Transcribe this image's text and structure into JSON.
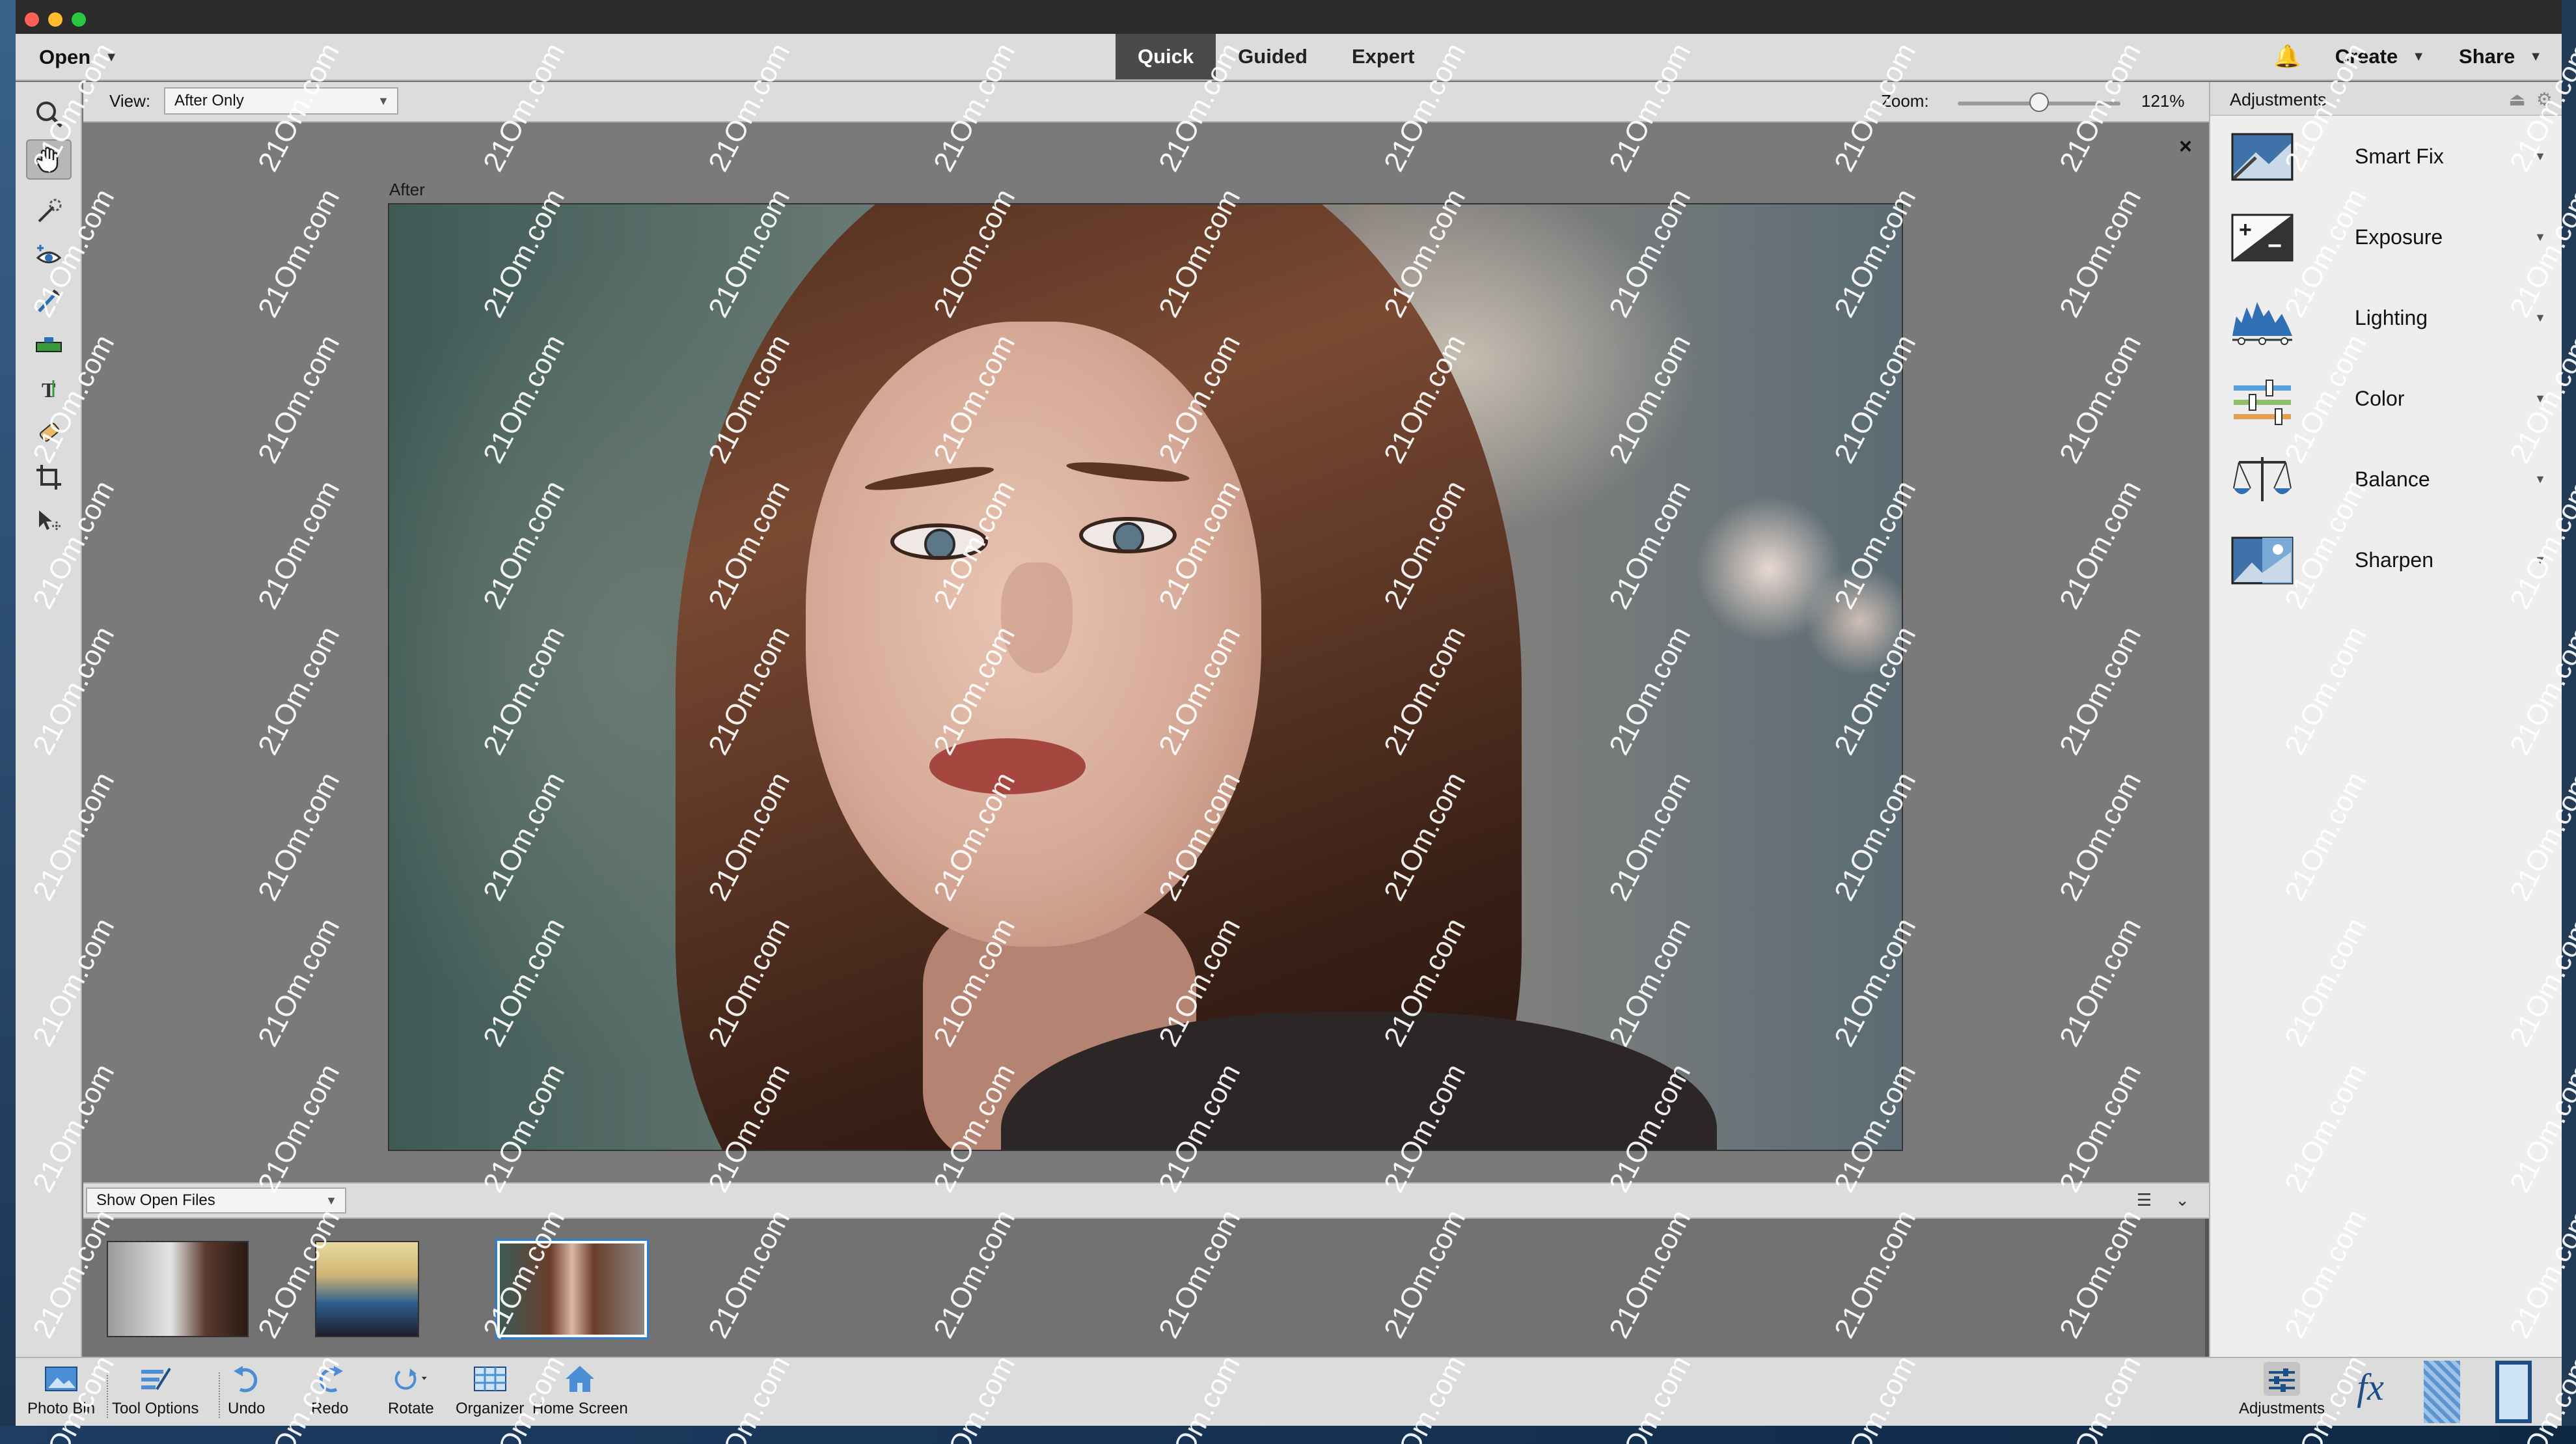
{
  "window": {
    "traffic_colors": [
      "#ff5f57",
      "#febc2e",
      "#28c840"
    ]
  },
  "topbar": {
    "open_label": "Open",
    "modes": [
      {
        "label": "Quick",
        "active": true
      },
      {
        "label": "Guided",
        "active": false
      },
      {
        "label": "Expert",
        "active": false
      }
    ],
    "create_label": "Create",
    "share_label": "Share"
  },
  "viewbar": {
    "view_label": "View:",
    "view_value": "After Only",
    "zoom_label": "Zoom:",
    "zoom_value": "121%"
  },
  "canvas": {
    "after_label": "After",
    "close_glyph": "×"
  },
  "bin": {
    "show_label": "Show Open Files",
    "thumbnails": [
      {
        "selected": false
      },
      {
        "selected": false
      },
      {
        "selected": true
      }
    ]
  },
  "panel": {
    "title": "Adjustments",
    "items": [
      {
        "label": "Smart Fix",
        "icon": "smart-fix-icon"
      },
      {
        "label": "Exposure",
        "icon": "exposure-icon"
      },
      {
        "label": "Lighting",
        "icon": "lighting-icon"
      },
      {
        "label": "Color",
        "icon": "color-icon"
      },
      {
        "label": "Balance",
        "icon": "balance-icon"
      },
      {
        "label": "Sharpen",
        "icon": "sharpen-icon"
      }
    ]
  },
  "taskbar": {
    "photo_bin": "Photo Bin",
    "tool_options": "Tool Options",
    "undo": "Undo",
    "redo": "Redo",
    "rotate": "Rotate",
    "organizer": "Organizer",
    "home_screen": "Home Screen",
    "adjustments": "Adjustments"
  },
  "watermark_text": "21Om.com",
  "colors": {
    "accent": "#1e7ad6",
    "active_mode_bg": "#4a4a4a"
  }
}
